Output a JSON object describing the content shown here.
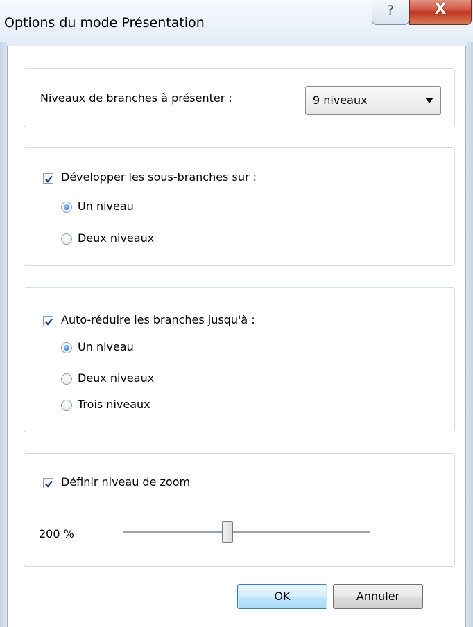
{
  "window": {
    "title": "Options du mode Présentation",
    "help_glyph": "?",
    "close_glyph": "X"
  },
  "levels": {
    "label": "Niveaux de branches à présenter :",
    "selected": "9 niveaux"
  },
  "expand": {
    "label": "Développer les sous-branches sur :",
    "checked": true,
    "options": [
      "Un niveau",
      "Deux niveaux"
    ],
    "selected_index": 0
  },
  "collapse": {
    "label": "Auto-réduire les branches jusqu'à :",
    "checked": true,
    "options": [
      "Un niveau",
      "Deux niveaux",
      "Trois niveaux"
    ],
    "selected_index": 0
  },
  "zoom": {
    "label": "Définir niveau de zoom",
    "checked": true,
    "value_text": "200 %",
    "slider_fraction": 0.42
  },
  "buttons": {
    "ok": "OK",
    "cancel": "Annuler"
  },
  "colors": {
    "close_red": "#c0391f",
    "ok_blue": "#3c7fb1",
    "radio_dot": "#1f67b8"
  }
}
